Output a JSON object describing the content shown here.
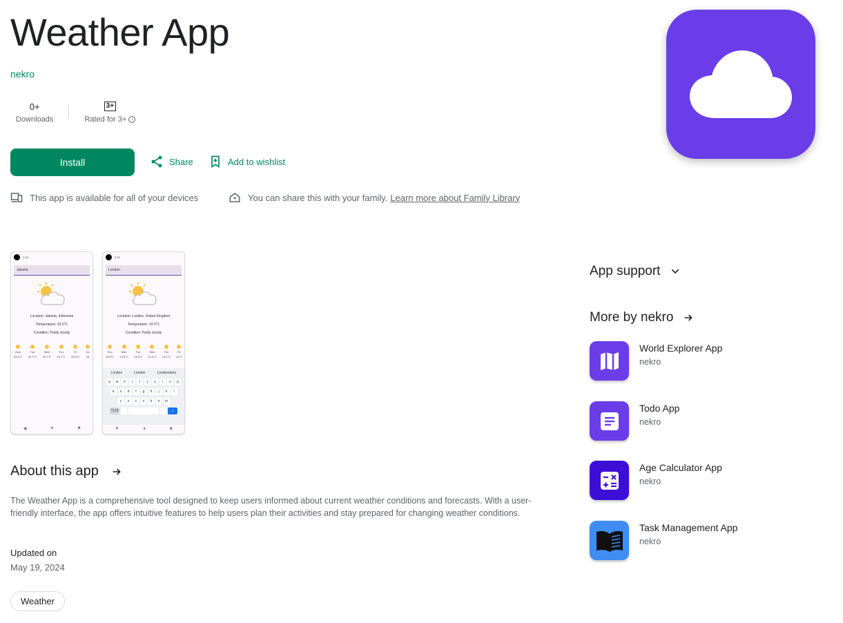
{
  "app": {
    "title": "Weather App",
    "developer": "nekro"
  },
  "stats": {
    "downloads_value": "0+",
    "downloads_label": "Downloads",
    "rating_badge": "3+",
    "rating_label": "Rated for 3+"
  },
  "actions": {
    "install": "Install",
    "share": "Share",
    "wishlist": "Add to wishlist"
  },
  "availability": {
    "devices_text": "This app is available for all of your devices",
    "family_text": "You can share this with your family.",
    "family_link": "Learn more about Family Library"
  },
  "icon": {
    "name": "cloud-icon",
    "color": "#6a3de8"
  },
  "screenshots": [
    {
      "time": "2:18",
      "city": "Jakarta",
      "location": "Location: Jakarta, Indonesia",
      "temperature": "Temperature: 33.0°C",
      "condition": "Condition: Partly cloudy",
      "days": [
        {
          "d": "Mon",
          "t": "29.3°C"
        },
        {
          "d": "Tue",
          "t": "29.7°C"
        },
        {
          "d": "Wed",
          "t": "29.7°C"
        },
        {
          "d": "Thu",
          "t": "29.7°C"
        },
        {
          "d": "Fri",
          "t": "29.6°C"
        },
        {
          "d": "Sa",
          "t": "28"
        }
      ]
    },
    {
      "time": "2:20",
      "city": "London",
      "location": "Location: London, United Kingdom",
      "temperature": "Temperature: 14.0°C",
      "condition": "Condition: Partly cloudy",
      "days": [
        {
          "d": "Sun",
          "t": "15.5°C"
        },
        {
          "d": "Mon",
          "t": "14.6°C"
        },
        {
          "d": "Tue",
          "t": "13.4°C"
        },
        {
          "d": "Wed",
          "t": "14.0°C"
        },
        {
          "d": "Thu",
          "t": "14.2°C"
        },
        {
          "d": "Fri",
          "t": "14.9"
        }
      ],
      "keyboard_suggestions": [
        "London",
        "Londen",
        "Londonderry"
      ],
      "keyboard_rows": [
        [
          "q",
          "w",
          "e",
          "r",
          "t",
          "y",
          "u",
          "i",
          "o",
          "p"
        ],
        [
          "a",
          "s",
          "d",
          "f",
          "g",
          "h",
          "j",
          "k",
          "l"
        ],
        [
          "z",
          "x",
          "c",
          "v",
          "b",
          "n",
          "m"
        ]
      ],
      "keyboard_numbers": "?123"
    }
  ],
  "about": {
    "heading": "About this app",
    "description": "The Weather App is a comprehensive tool designed to keep users informed about current weather conditions and forecasts. With a user-friendly interface, the app offers intuitive features to help users plan their activities and stay prepared for changing weather conditions.",
    "updated_label": "Updated on",
    "updated_value": "May 19, 2024",
    "tag": "Weather"
  },
  "sidebar": {
    "app_support": "App support",
    "more_by": "More by nekro",
    "apps": [
      {
        "name": "World Explorer App",
        "developer": "nekro",
        "color": "#6a3de8",
        "icon": "map-icon"
      },
      {
        "name": "Todo App",
        "developer": "nekro",
        "color": "#6a3de8",
        "icon": "list-icon"
      },
      {
        "name": "Age Calculator App",
        "developer": "nekro",
        "color": "#3d0fd6",
        "icon": "calculator-icon"
      },
      {
        "name": "Task Management App",
        "developer": "nekro",
        "color": "#3f8cf3",
        "icon": "book-icon"
      }
    ]
  }
}
